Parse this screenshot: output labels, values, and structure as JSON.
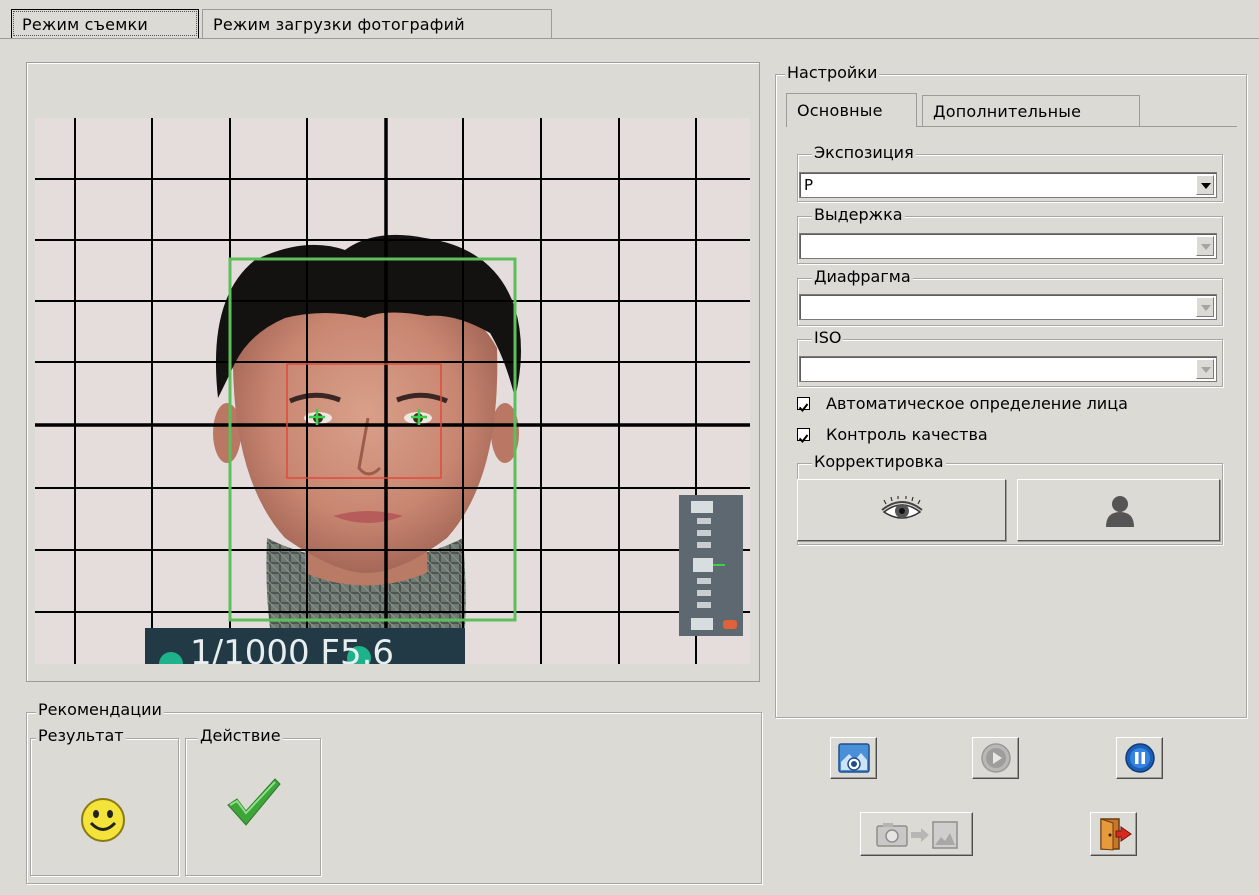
{
  "tabs": [
    {
      "label": "Режим съемки",
      "active": true
    },
    {
      "label": "Режим загрузки фотографий",
      "active": false
    }
  ],
  "camera": {
    "overlay_text": "1/1000 F5.6"
  },
  "settings": {
    "title": "Настройки",
    "tabs": [
      {
        "label": "Основные",
        "active": true
      },
      {
        "label": "Дополнительные",
        "active": false
      }
    ],
    "exposure": {
      "label": "Экспозиция",
      "value": "P",
      "enabled": true
    },
    "shutter": {
      "label": "Выдержка",
      "value": "",
      "enabled": false
    },
    "aperture": {
      "label": "Диафрагма",
      "value": "",
      "enabled": false
    },
    "iso": {
      "label": "ISO",
      "value": "",
      "enabled": false
    },
    "auto_face": {
      "label": "Автоматическое определение лица",
      "checked": true
    },
    "quality": {
      "label": "Контроль качества",
      "checked": true
    },
    "correction": {
      "label": "Корректировка",
      "buttons": [
        "eye-icon",
        "person-icon"
      ]
    }
  },
  "recommendations": {
    "title": "Рекомендации",
    "result_label": "Результат",
    "action_label": "Действие",
    "result_icon": "smiley-icon",
    "action_icon": "checkmark-icon"
  },
  "colors": {
    "background": "#dcdad5",
    "face_frame": "#5cbf5c",
    "eye_frame": "#e04a3a",
    "eye_marker": "#3ad04a",
    "play_button": "#1a5fb4"
  }
}
